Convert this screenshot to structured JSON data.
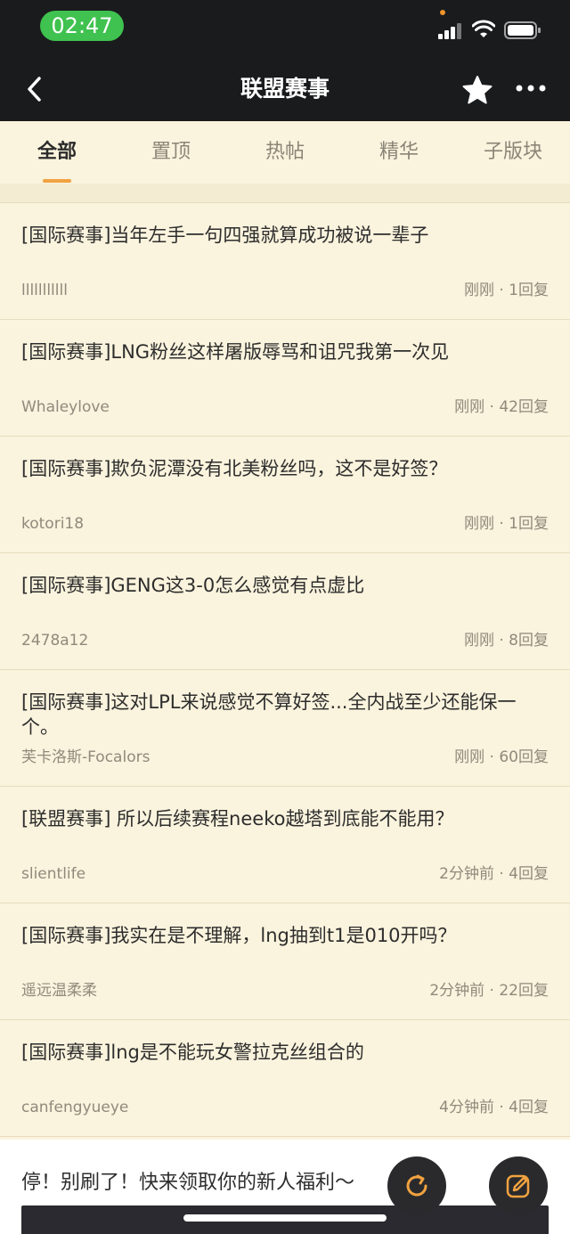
{
  "status_bar": {
    "time": "02:47"
  },
  "nav": {
    "title": "联盟赛事"
  },
  "tabs": [
    {
      "label": "全部"
    },
    {
      "label": "置顶"
    },
    {
      "label": "热帖"
    },
    {
      "label": "精华"
    },
    {
      "label": "子版块"
    }
  ],
  "posts": [
    {
      "title": "[国际赛事]当年左手一句四强就算成功被说一辈子",
      "author": "lllllllllll",
      "meta": "刚刚 · 1回复"
    },
    {
      "title": "[国际赛事]LNG粉丝这样屠版辱骂和诅咒我第一次见",
      "author": "Whaleylove",
      "meta": "刚刚 · 42回复"
    },
    {
      "title": "[国际赛事]欺负泥潭没有北美粉丝吗，这不是好签？",
      "author": "kotori18",
      "meta": "刚刚 · 1回复"
    },
    {
      "title": "[国际赛事]GENG这3-0怎么感觉有点虚比",
      "author": "2478a12",
      "meta": "刚刚 · 8回复"
    },
    {
      "title": "[国际赛事]这对LPL来说感觉不算好签...全内战至少还能保一个。",
      "author": "芙卡洛斯-Focalors",
      "meta": "刚刚 · 60回复"
    },
    {
      "title": "[联盟赛事] 所以后续赛程neeko越塔到底能不能用？",
      "author": "slientlife",
      "meta": "2分钟前 · 4回复"
    },
    {
      "title": "[国际赛事]我实在是不理解，lng抽到t1是010开吗？",
      "author": "遥远温柔柔",
      "meta": "2分钟前 · 22回复"
    },
    {
      "title": "[国际赛事]lng是不能玩女警拉克丝组合的",
      "author": "canfengyueye",
      "meta": "4分钟前 · 4回复"
    }
  ],
  "promo": {
    "text": "停！别刷了！快来领取你的新人福利～"
  },
  "colors": {
    "accent": "#f1a240",
    "background": "#faf3dd",
    "header": "#1a1b1d"
  }
}
